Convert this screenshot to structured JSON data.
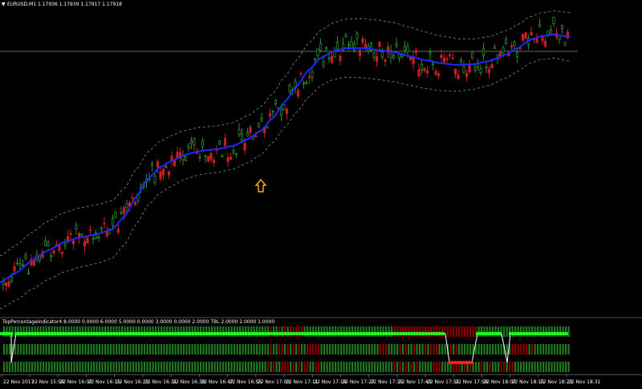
{
  "chart_data": {
    "type": "candlestick",
    "header": {
      "arrow_glyph": "▼",
      "symbol_line": "EURUSD,M1  1.17936 1.17939 1.17917 1.17918"
    },
    "indicator": {
      "label": "TopPercentageIndicator4 8.0000 0.0000 6.0000 5.0000 0.0000 3.0000 0.0000 2.0000  TBL 2.0000 2.0000 1.0000",
      "rows": 3
    },
    "x_ticks": [
      "22 Nov 2017",
      "22 Nov 15:59",
      "22 Nov 16:07",
      "22 Nov 16:15",
      "22 Nov 16:23",
      "22 Nov 16:31",
      "22 Nov 16:39",
      "22 Nov 16:47",
      "22 Nov 16:55",
      "22 Nov 17:03",
      "22 Nov 17:11",
      "22 Nov 17:19",
      "22 Nov 17:27",
      "22 Nov 17:35",
      "22 Nov 17:43",
      "22 Nov 17:51",
      "22 Nov 17:59",
      "22 Nov 18:07",
      "22 Nov 18:15",
      "22 Nov 18:23",
      "22 Nov 18:31"
    ],
    "ma_points": [
      [
        0,
        352
      ],
      [
        20,
        340
      ],
      [
        40,
        325
      ],
      [
        60,
        312
      ],
      [
        80,
        302
      ],
      [
        100,
        296
      ],
      [
        120,
        292
      ],
      [
        140,
        286
      ],
      [
        155,
        270
      ],
      [
        170,
        245
      ],
      [
        185,
        222
      ],
      [
        200,
        208
      ],
      [
        215,
        200
      ],
      [
        230,
        193
      ],
      [
        250,
        188
      ],
      [
        270,
        186
      ],
      [
        290,
        182
      ],
      [
        310,
        173
      ],
      [
        325,
        163
      ],
      [
        340,
        147
      ],
      [
        355,
        127
      ],
      [
        370,
        107
      ],
      [
        385,
        87
      ],
      [
        400,
        72
      ],
      [
        415,
        64
      ],
      [
        430,
        60
      ],
      [
        450,
        60
      ],
      [
        470,
        62
      ],
      [
        490,
        65
      ],
      [
        510,
        70
      ],
      [
        530,
        75
      ],
      [
        550,
        79
      ],
      [
        570,
        81
      ],
      [
        590,
        80
      ],
      [
        610,
        76
      ],
      [
        630,
        68
      ],
      [
        645,
        60
      ],
      [
        660,
        50
      ],
      [
        675,
        45
      ],
      [
        690,
        43
      ],
      [
        710,
        46
      ]
    ],
    "band_offset": 33,
    "horizontal_line_y": 64,
    "signal_arrow": {
      "x": 325,
      "y": 232
    },
    "bars_start_x": 4,
    "bars_end_x": 708,
    "bar_step": 3.5,
    "indicator_row1_colors": [
      [
        0,
        0,
        "green"
      ],
      [
        335,
        380,
        "mixed"
      ],
      [
        490,
        560,
        "red"
      ],
      [
        560,
        593,
        "red"
      ],
      [
        593,
        708,
        "green"
      ]
    ],
    "indicator_row2_colors": [
      [
        0,
        0,
        "green"
      ],
      [
        330,
        410,
        "mixed"
      ],
      [
        470,
        545,
        "mixed"
      ],
      [
        560,
        585,
        "mixed"
      ],
      [
        635,
        665,
        "mixed"
      ]
    ],
    "indicator_row3_colors": [
      [
        0,
        0,
        "green"
      ],
      [
        330,
        420,
        "mixed"
      ],
      [
        480,
        640,
        "mixed"
      ]
    ],
    "bright_line": [
      [
        0,
        416
      ],
      [
        14,
        416
      ],
      [
        14,
        452
      ],
      [
        20,
        416
      ],
      [
        555,
        416
      ],
      [
        560,
        452
      ],
      [
        588,
        452
      ],
      [
        595,
        416
      ],
      [
        625,
        416
      ],
      [
        632,
        452
      ],
      [
        636,
        416
      ],
      [
        708,
        416
      ]
    ],
    "colors": {
      "background": "#000000",
      "bull": "#2e8b2e",
      "bear": "#c81e1e",
      "ma": "#1a2cff",
      "band": "#8c8c8c",
      "bright_green": "#22ff22",
      "bright_red": "#ff2020",
      "dark_green": "#1f7a1f",
      "dark_red": "#8b0000",
      "arrow": "#ffb000",
      "grid_line": "#8c8c8c",
      "text": "#ffffff"
    }
  }
}
